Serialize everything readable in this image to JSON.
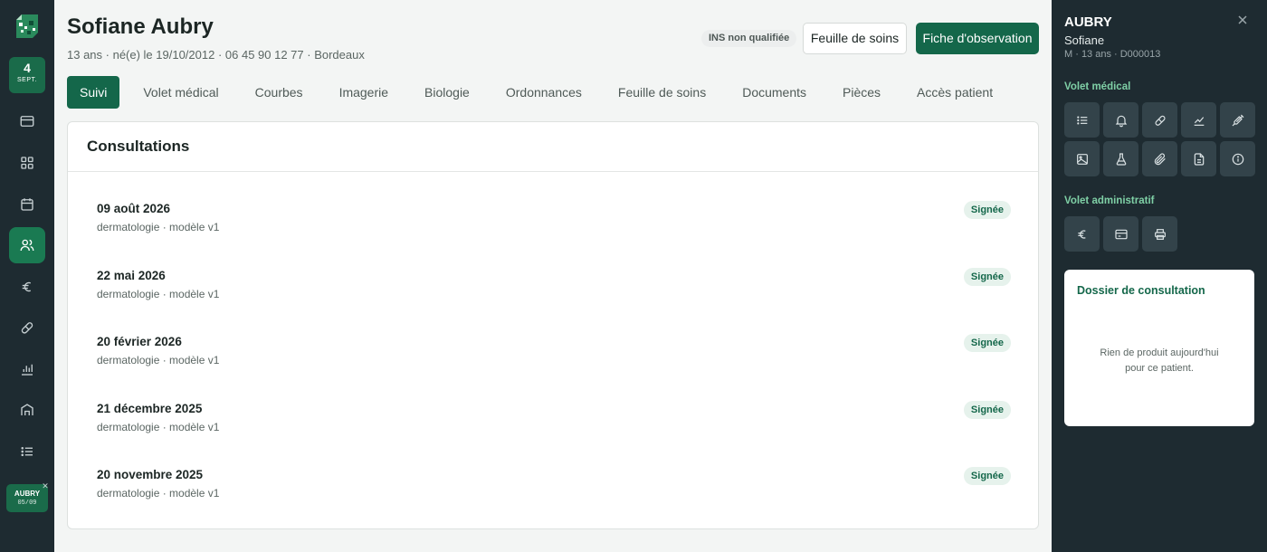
{
  "rail": {
    "date_day": "4",
    "date_month": "SEPT.",
    "nav": [
      {
        "name": "billing",
        "icon": "card-icon"
      },
      {
        "name": "dashboard",
        "icon": "grid-icon"
      },
      {
        "name": "calendar",
        "icon": "calendar-icon"
      },
      {
        "name": "patients",
        "icon": "users-icon",
        "active": true
      },
      {
        "name": "finance",
        "icon": "euro-icon"
      },
      {
        "name": "prescriptions",
        "icon": "pill-icon"
      },
      {
        "name": "stats",
        "icon": "bar-chart-icon"
      },
      {
        "name": "practice",
        "icon": "building-icon"
      },
      {
        "name": "lists",
        "icon": "list-icon"
      }
    ],
    "patient_chip": {
      "name": "AUBRY",
      "date": "05/09"
    }
  },
  "patient": {
    "name": "Sofiane Aubry",
    "subtitle": "13 ans · né(e) le 19/10/2012 · 06 45 90 12 77 · Bordeaux",
    "ins_status": "INS non qualifiée"
  },
  "actions": {
    "sheet_label": "Feuille de soins",
    "observation_label": "Fiche d'observation"
  },
  "tabs": [
    "Suivi",
    "Volet médical",
    "Courbes",
    "Imagerie",
    "Biologie",
    "Ordonnances",
    "Feuille de soins",
    "Documents",
    "Pièces",
    "Accès patient"
  ],
  "active_tab": "Suivi",
  "consultations": {
    "title": "Consultations",
    "items": [
      {
        "date": "09 août 2026",
        "meta": "dermatologie · modèle v1",
        "status": "Signée"
      },
      {
        "date": "22 mai 2026",
        "meta": "dermatologie · modèle v1",
        "status": "Signée"
      },
      {
        "date": "20 février 2026",
        "meta": "dermatologie · modèle v1",
        "status": "Signée"
      },
      {
        "date": "21 décembre 2025",
        "meta": "dermatologie · modèle v1",
        "status": "Signée"
      },
      {
        "date": "20 novembre 2025",
        "meta": "dermatologie · modèle v1",
        "status": "Signée"
      }
    ]
  },
  "right_panel": {
    "last_name": "AUBRY",
    "first_name": "Sofiane",
    "meta": "M · 13 ans · D000013",
    "medical_section": "Volet médical",
    "medical_icons": [
      "list-icon",
      "bell-icon",
      "pill-icon",
      "chart-line-icon",
      "syringe-icon",
      "image-icon",
      "flask-icon",
      "paperclip-icon",
      "document-icon",
      "info-icon"
    ],
    "admin_section": "Volet administratif",
    "admin_icons": [
      "euro-icon",
      "card-icon",
      "printer-icon"
    ],
    "dossier_title": "Dossier de consultation",
    "dossier_empty_line1": "Rien de produit aujourd'hui",
    "dossier_empty_line2": "pour ce patient."
  },
  "colors": {
    "accent": "#14674a",
    "rail_bg": "#1e2b31",
    "badge_bg": "#e6f2ec",
    "section_label": "#7fd0a6"
  }
}
